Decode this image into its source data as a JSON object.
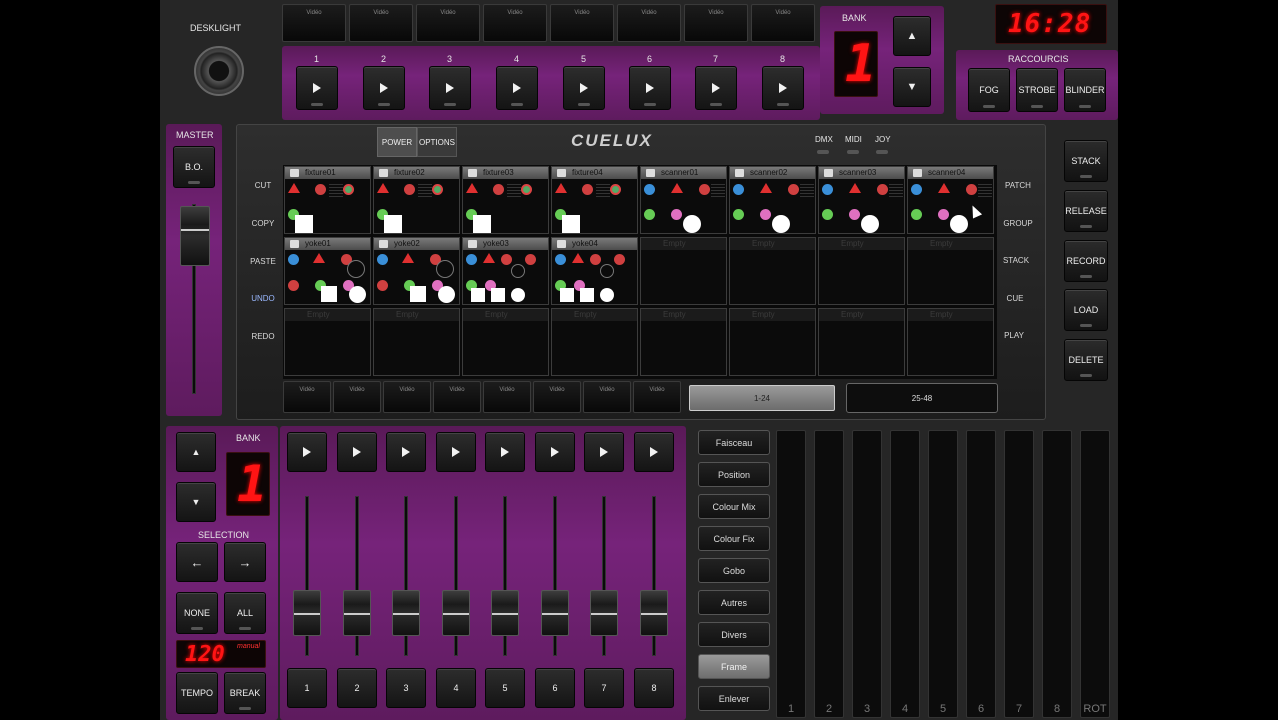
{
  "header": {
    "desklight": "DESKLIGHT",
    "video_label": "Vidéo",
    "cue_numbers": [
      "1",
      "2",
      "3",
      "4",
      "5",
      "6",
      "7",
      "8"
    ],
    "bank_label": "BANK",
    "bank_value": "1",
    "clock": "16:28",
    "raccourcis": "RACCOURCIS",
    "shortcuts": [
      "FOG",
      "STROBE",
      "BLINDER"
    ]
  },
  "master": {
    "label": "MASTER",
    "bo": "B.O."
  },
  "center": {
    "tabs": [
      "POWER",
      "OPTIONS"
    ],
    "logo": "CUELUX",
    "indicators": [
      "DMX",
      "MIDI",
      "JOY"
    ],
    "left_actions": [
      "CUT",
      "COPY",
      "PASTE",
      "UNDO",
      "REDO"
    ],
    "right_actions": [
      "PATCH",
      "GROUP",
      "STACK",
      "CUE",
      "PLAY"
    ],
    "fixtures_row1": [
      "fixture01",
      "fixture02",
      "fixture03",
      "fixture04",
      "scanner01",
      "scanner02",
      "scanner03",
      "scanner04"
    ],
    "fixtures_row2": [
      "yoke01",
      "yoke02",
      "yoke03",
      "yoke04",
      "Empty",
      "Empty",
      "Empty",
      "Empty"
    ],
    "fixtures_row3": [
      "Empty",
      "Empty",
      "Empty",
      "Empty",
      "Empty",
      "Empty",
      "Empty",
      "Empty"
    ],
    "pages": [
      "1-24",
      "25-48"
    ]
  },
  "right_panel": [
    "STACK",
    "RELEASE",
    "RECORD",
    "LOAD",
    "DELETE"
  ],
  "bottom": {
    "bank_label": "BANK",
    "bank_value": "1",
    "selection": "SELECTION",
    "none": "NONE",
    "all": "ALL",
    "tempo_value": "120",
    "tempo_mode": "manual",
    "tempo": "TEMPO",
    "break": "BREAK",
    "fader_numbers": [
      "1",
      "2",
      "3",
      "4",
      "5",
      "6",
      "7",
      "8"
    ],
    "categories": [
      "Faisceau",
      "Position",
      "Colour Mix",
      "Colour Fix",
      "Gobo",
      "Autres",
      "Divers",
      "Frame",
      "Enlever"
    ],
    "active_category": "Frame",
    "meters": [
      "1",
      "2",
      "3",
      "4",
      "5",
      "6",
      "7",
      "8",
      "ROT"
    ]
  },
  "colors": {
    "accent": "#76237a",
    "led": "#ff1414"
  }
}
